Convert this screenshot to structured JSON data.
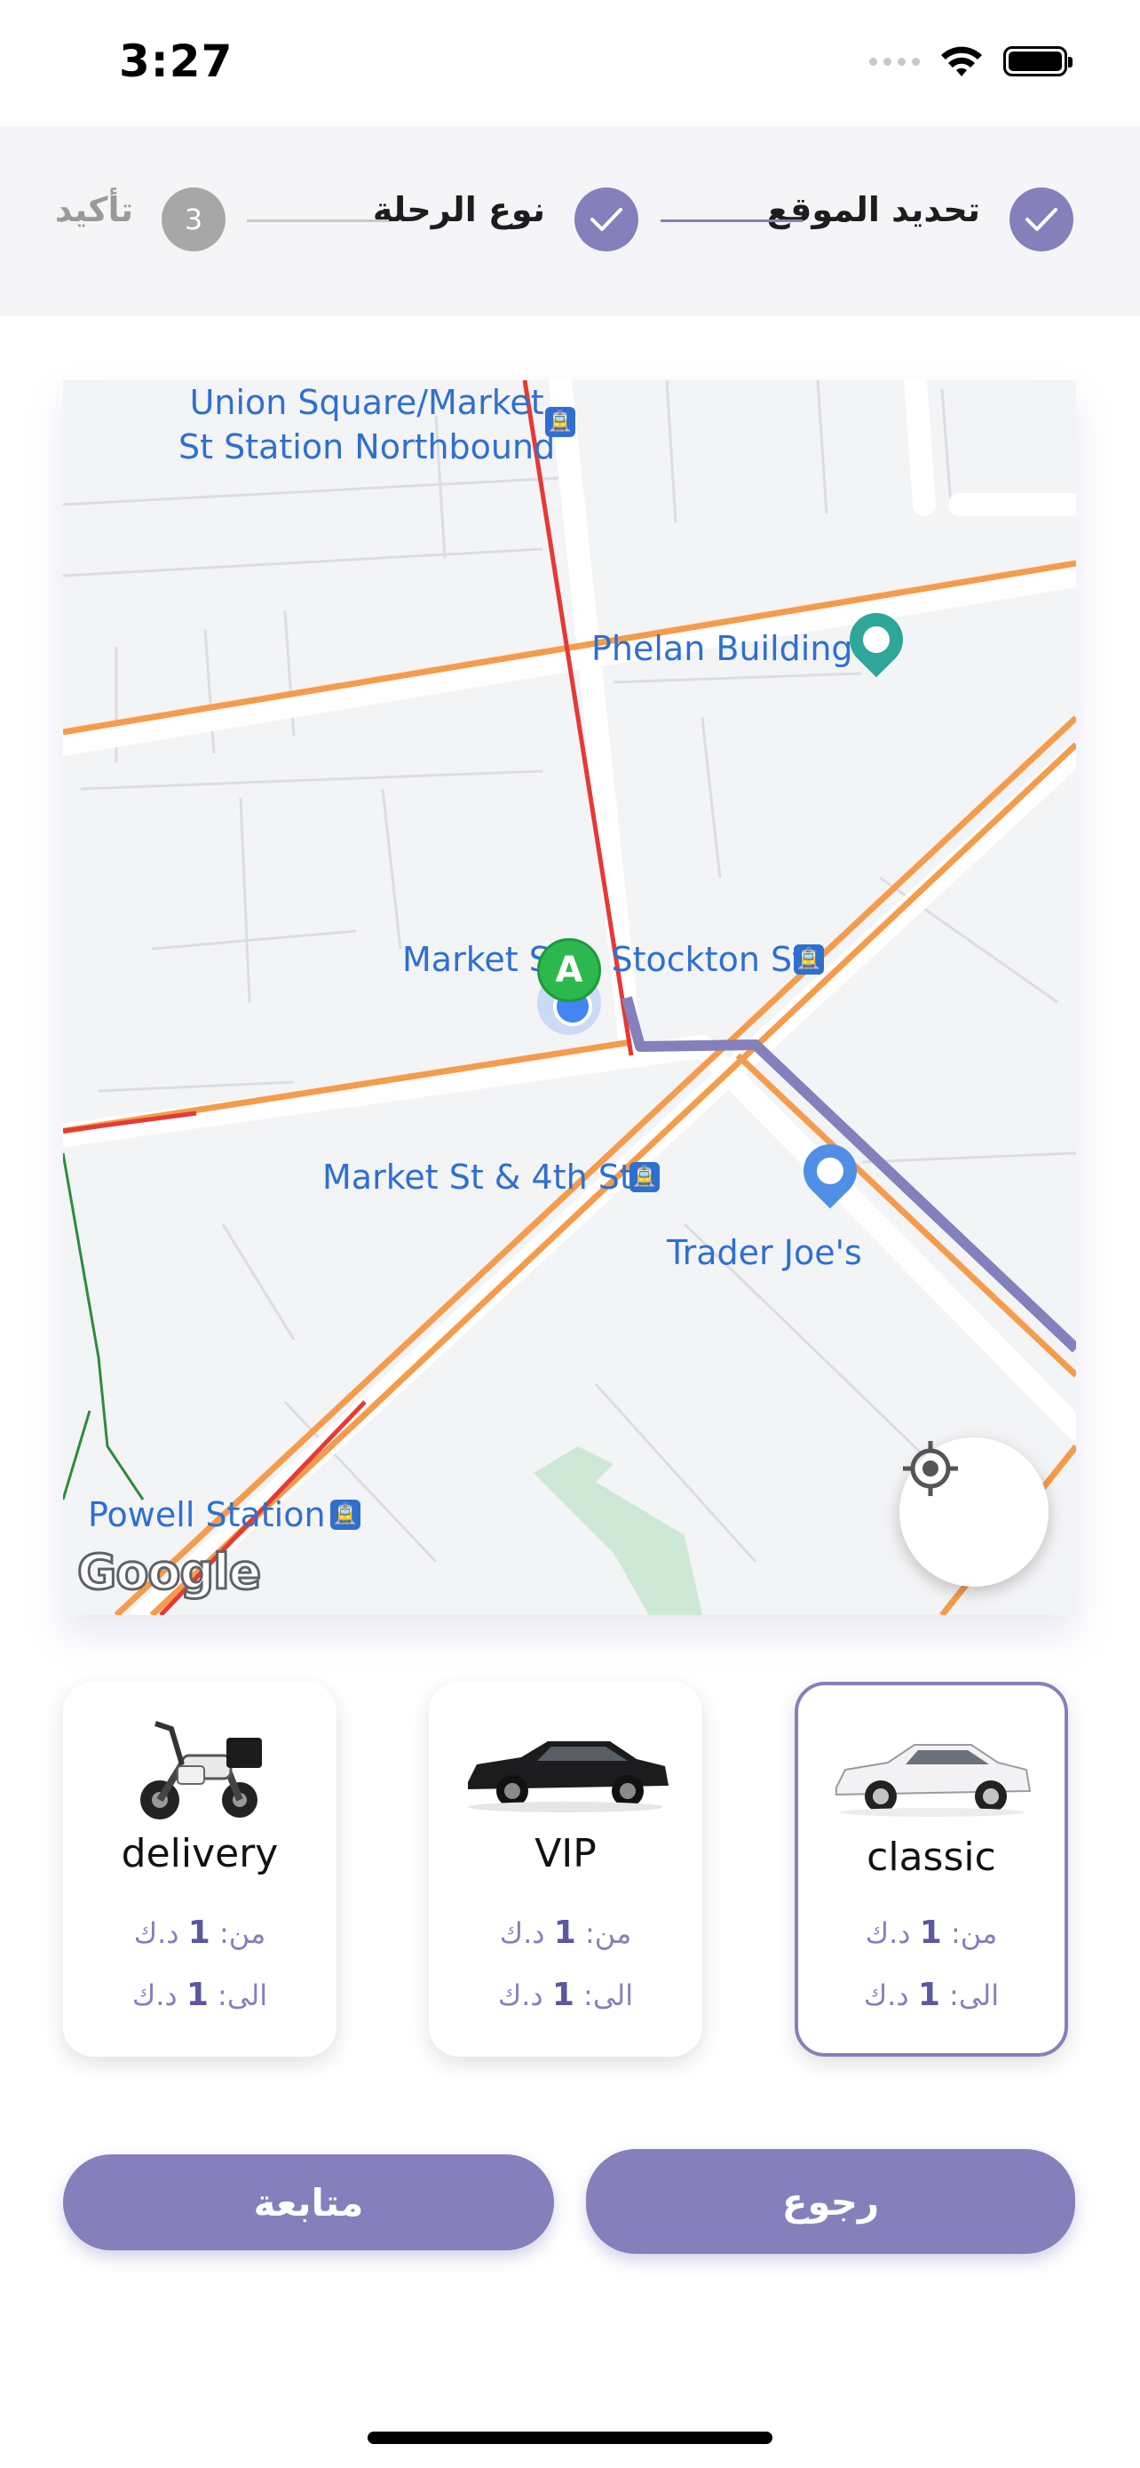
{
  "status_bar": {
    "time": "3:27"
  },
  "stepper": {
    "steps": [
      {
        "label": "تحديد الموقع",
        "state": "done"
      },
      {
        "label": "نوع الرحلة",
        "state": "done"
      },
      {
        "label": "تأكيد",
        "state": "pending",
        "number": "3"
      }
    ],
    "active_color": "#8580bb"
  },
  "map": {
    "labels": {
      "union_square": "Union Square/Market\nSt Station Northbound",
      "phelan": "Phelan Building",
      "market_stockton": "Market St & Stockton St",
      "market_4th": "Market St & 4th St",
      "trader_joes": "Trader Joe's",
      "powell": "Powell Station"
    },
    "marker": "A",
    "attribution": "Google"
  },
  "vehicles": [
    {
      "name": "delivery",
      "from": "من: ",
      "from_value": "1",
      "to": "الى: ",
      "to_value": "1",
      "currency": " د.ك",
      "selected": false,
      "icon": "scooter-icon"
    },
    {
      "name": "VIP",
      "from": "من: ",
      "from_value": "1",
      "to": "الى: ",
      "to_value": "1",
      "currency": " د.ك",
      "selected": false,
      "icon": "luxury-car-icon"
    },
    {
      "name": "classic",
      "from": "من: ",
      "from_value": "1",
      "to": "الى: ",
      "to_value": "1",
      "currency": " د.ك",
      "selected": true,
      "icon": "sedan-car-icon"
    }
  ],
  "buttons": {
    "continue": "متابعة",
    "back": "رجوع"
  },
  "colors": {
    "accent": "#8580bb",
    "route": "#8580bb",
    "major_road": "#f59b4c",
    "rail": "#e53935"
  }
}
